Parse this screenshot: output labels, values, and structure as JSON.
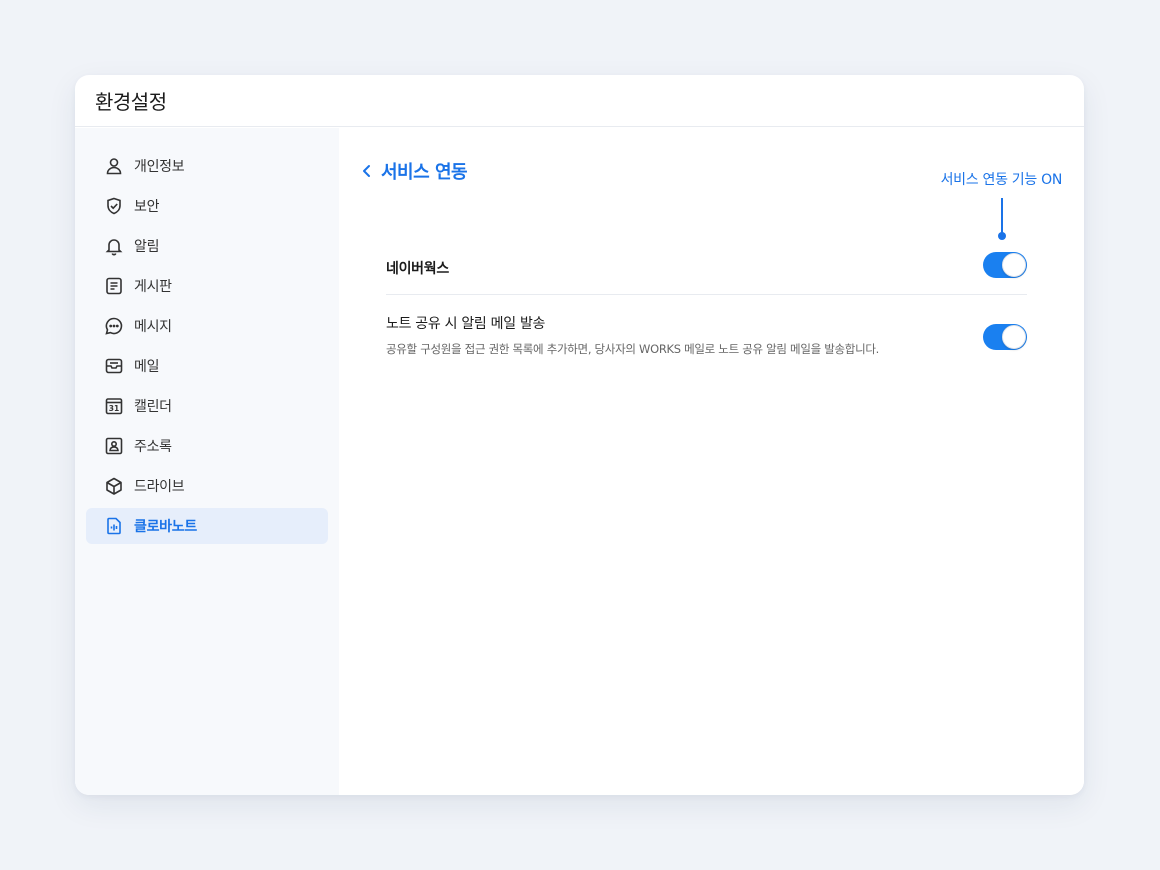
{
  "window": {
    "title": "환경설정"
  },
  "sidebar": {
    "items": [
      {
        "label": "개인정보",
        "icon": "person-icon",
        "active": false
      },
      {
        "label": "보안",
        "icon": "shield-check-icon",
        "active": false
      },
      {
        "label": "알림",
        "icon": "bell-icon",
        "active": false
      },
      {
        "label": "게시판",
        "icon": "board-icon",
        "active": false
      },
      {
        "label": "메시지",
        "icon": "chat-bubble-icon",
        "active": false
      },
      {
        "label": "메일",
        "icon": "mail-icon",
        "active": false
      },
      {
        "label": "캘린더",
        "icon": "calendar-icon",
        "active": false,
        "icon_text": "31"
      },
      {
        "label": "주소록",
        "icon": "contact-card-icon",
        "active": false
      },
      {
        "label": "드라이브",
        "icon": "cube-icon",
        "active": false
      },
      {
        "label": "클로바노트",
        "icon": "audio-note-icon",
        "active": true
      }
    ]
  },
  "content": {
    "back_title": "서비스 연동",
    "annotation": "서비스 연동 기능 ON",
    "settings": [
      {
        "title": "네이버웍스",
        "description": "",
        "enabled": true
      },
      {
        "title": "노트 공유 시 알림 메일 발송",
        "description": "공유할 구성원을 접근 권한 목록에 추가하면, 당사자의 WORKS 메일로 노트 공유 알림 메일을 발송합니다.",
        "enabled": true
      }
    ]
  },
  "colors": {
    "accent": "#1a73e8",
    "toggle_on": "#1a80f0",
    "page_bg": "#f0f3f8",
    "sidebar_bg": "#f7f9fc",
    "active_item_bg": "#e6eefb"
  }
}
